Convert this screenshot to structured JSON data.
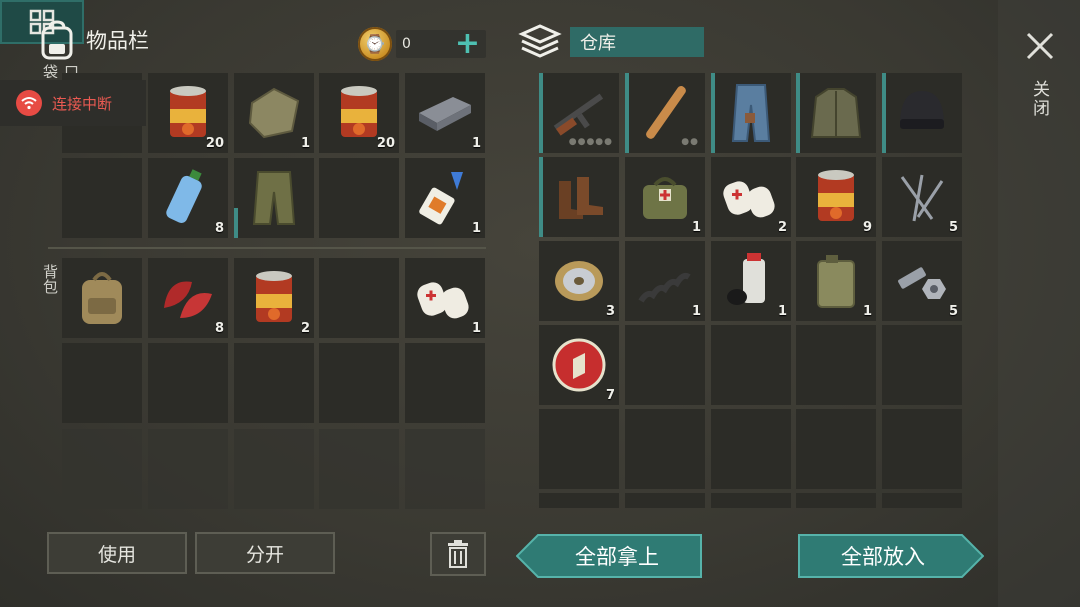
{
  "inventory": {
    "title": "物品栏",
    "coins": "0",
    "pockets_label": "口袋",
    "backpack_label": "背包"
  },
  "warehouse": {
    "title": "仓库"
  },
  "close_label": "关闭",
  "connection": {
    "status": "连接中断"
  },
  "buttons": {
    "use": "使用",
    "split": "分开",
    "take_all": "全部拿上",
    "put_all": "全部放入"
  },
  "colors": {
    "accent": "#4ec0b2",
    "warehouse_name_bg": "#2f6b66",
    "disconnect": "#e74b44"
  },
  "pockets_slots": [
    {
      "item": "",
      "count": ""
    },
    {
      "item": "canned-food",
      "count": "20"
    },
    {
      "item": "cloth-rag",
      "count": "1"
    },
    {
      "item": "canned-food",
      "count": "20"
    },
    {
      "item": "iron-bar",
      "count": "1"
    },
    {
      "item": "",
      "count": ""
    },
    {
      "item": "water-bottle",
      "count": "8"
    },
    {
      "item": "camo-pants",
      "count": ""
    },
    {
      "item": "",
      "count": ""
    },
    {
      "item": "glue",
      "count": "1"
    }
  ],
  "backpack_slots": [
    {
      "item": "backpack",
      "count": ""
    },
    {
      "item": "raw-meat",
      "count": "8"
    },
    {
      "item": "canned-food",
      "count": "2"
    },
    {
      "item": "",
      "count": ""
    },
    {
      "item": "bandage",
      "count": "1"
    }
  ],
  "warehouse_slots": [
    {
      "item": "ak-rifle",
      "count": ""
    },
    {
      "item": "baseball-bat",
      "count": ""
    },
    {
      "item": "jeans",
      "count": ""
    },
    {
      "item": "jacket",
      "count": ""
    },
    {
      "item": "beanie",
      "count": ""
    },
    {
      "item": "boots",
      "count": ""
    },
    {
      "item": "medkit-bag",
      "count": "1"
    },
    {
      "item": "bandage",
      "count": "2"
    },
    {
      "item": "canned-food",
      "count": "9"
    },
    {
      "item": "nails",
      "count": "5"
    },
    {
      "item": "wire-spool",
      "count": "3"
    },
    {
      "item": "spring",
      "count": "1"
    },
    {
      "item": "spray-paint",
      "count": "1"
    },
    {
      "item": "jerrycan",
      "count": "1"
    },
    {
      "item": "bolts",
      "count": "5"
    },
    {
      "item": "bottle-cap",
      "count": "7"
    }
  ]
}
